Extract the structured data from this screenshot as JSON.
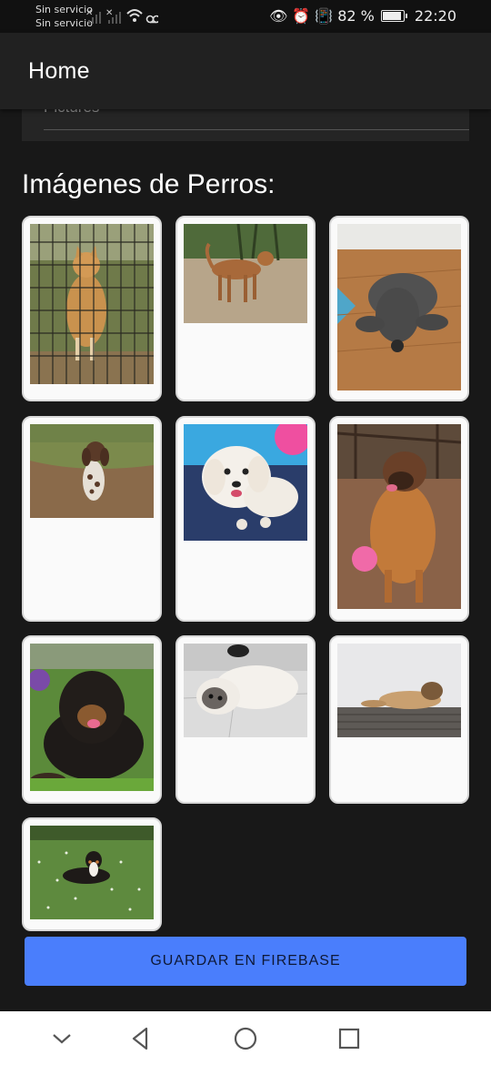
{
  "status_bar": {
    "carrier_1": "Sin servicio",
    "carrier_2": "Sin servicio",
    "battery": "82 %",
    "battery_level": 0.82,
    "time": "22:20"
  },
  "app_bar": {
    "title": "Home"
  },
  "previous_card": {
    "text": "Pictures"
  },
  "gallery": {
    "title": "Imágenes de Perros:",
    "photos": [
      {
        "icon": "shiba-behind-fence-photo"
      },
      {
        "icon": "brown-dog-standing-photo"
      },
      {
        "icon": "grey-poodle-lying-photo"
      },
      {
        "icon": "spaniel-in-field-photo"
      },
      {
        "icon": "white-fluffy-dog-photo"
      },
      {
        "icon": "leonberger-sitting-photo"
      },
      {
        "icon": "tibetan-mastiff-photo"
      },
      {
        "icon": "shih-tzu-lying-photo"
      },
      {
        "icon": "dog-lying-on-deck-photo"
      },
      {
        "icon": "bernese-puppy-in-grass-photo"
      }
    ]
  },
  "save_button": {
    "label": "GUARDAR EN FIREBASE"
  },
  "colors": {
    "accent": "#4a7efc",
    "background": "#181818",
    "appbar": "#212121",
    "tile": "#fafafa"
  },
  "nav_bar": {
    "icons": [
      "chevron-down-icon",
      "back-triangle-icon",
      "home-circle-icon",
      "recents-square-icon"
    ]
  }
}
